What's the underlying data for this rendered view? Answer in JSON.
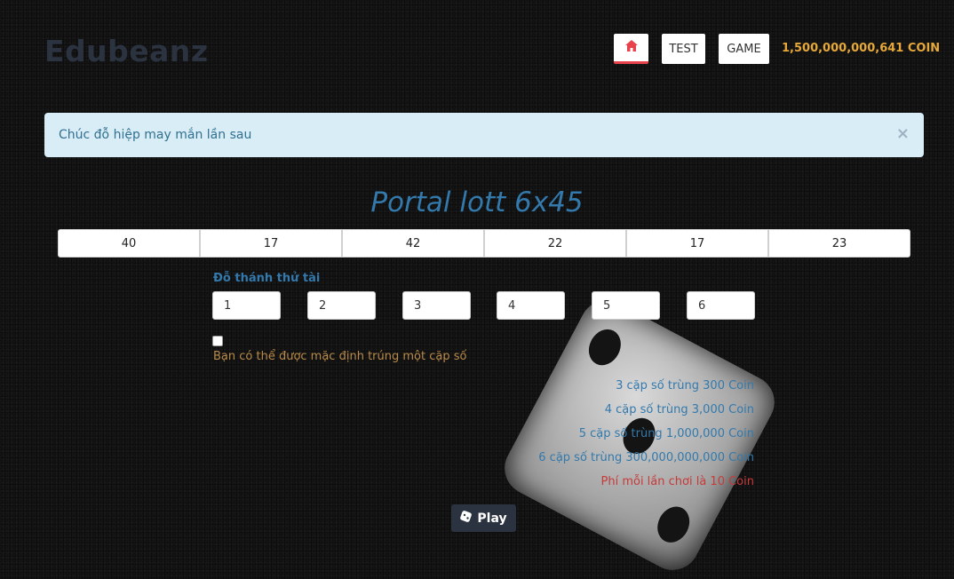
{
  "header": {
    "brand": "Edubeanz",
    "nav": [
      {
        "label": "",
        "icon": "home-icon"
      },
      {
        "label": "TEST"
      },
      {
        "label": "GAME"
      }
    ],
    "coin_balance": "1,500,000,000,641 COIN",
    "accent_color": "#e8424c",
    "coin_color": "#e7a83a"
  },
  "alert": {
    "message": "Chúc đỗ hiệp may mắn lần sau",
    "close_symbol": "×"
  },
  "game": {
    "title": "Portal lott 6x45",
    "results": [
      "40",
      "17",
      "42",
      "22",
      "17",
      "23"
    ],
    "guess_label": "Đỗ thánh thử tài",
    "guesses": [
      "1",
      "2",
      "3",
      "4",
      "5",
      "6"
    ],
    "default_pair_checked": false,
    "default_pair_label": "Bạn có thể được mặc định trúng một cặp số",
    "prizes": [
      "3 cặp số trùng 300 Coin",
      "4 cặp số trùng 3,000 Coin",
      "5 cặp số trùng 1,000,000 Coin",
      "6 cặp số trùng 300,000,000,000 Coin"
    ],
    "fee": "Phí mỗi lần chơi là 10 Coin",
    "play_label": "Play",
    "play_icon": "dice-icon"
  }
}
